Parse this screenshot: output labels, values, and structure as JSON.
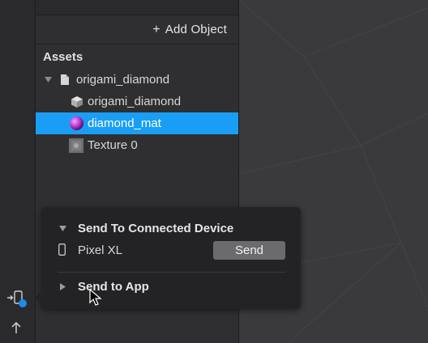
{
  "toolbar": {
    "add_object_label": "Add Object",
    "add_icon": "plus-icon"
  },
  "assets": {
    "header": "Assets",
    "tree": [
      {
        "label": "origami_diamond",
        "icon": "file-icon",
        "expanded": true
      },
      {
        "label": "origami_diamond",
        "icon": "cube-icon"
      },
      {
        "label": "diamond_mat",
        "icon": "material-sphere-icon",
        "selected": true
      },
      {
        "label": "Texture 0",
        "icon": "texture-icon"
      }
    ]
  },
  "popup": {
    "section1_title": "Send To Connected Device",
    "device_name": "Pixel XL",
    "send_label": "Send",
    "section2_title": "Send to App"
  },
  "colors": {
    "selection": "#1a9ef5",
    "status_dot": "#1a8cf0",
    "material": "#c040d8"
  }
}
